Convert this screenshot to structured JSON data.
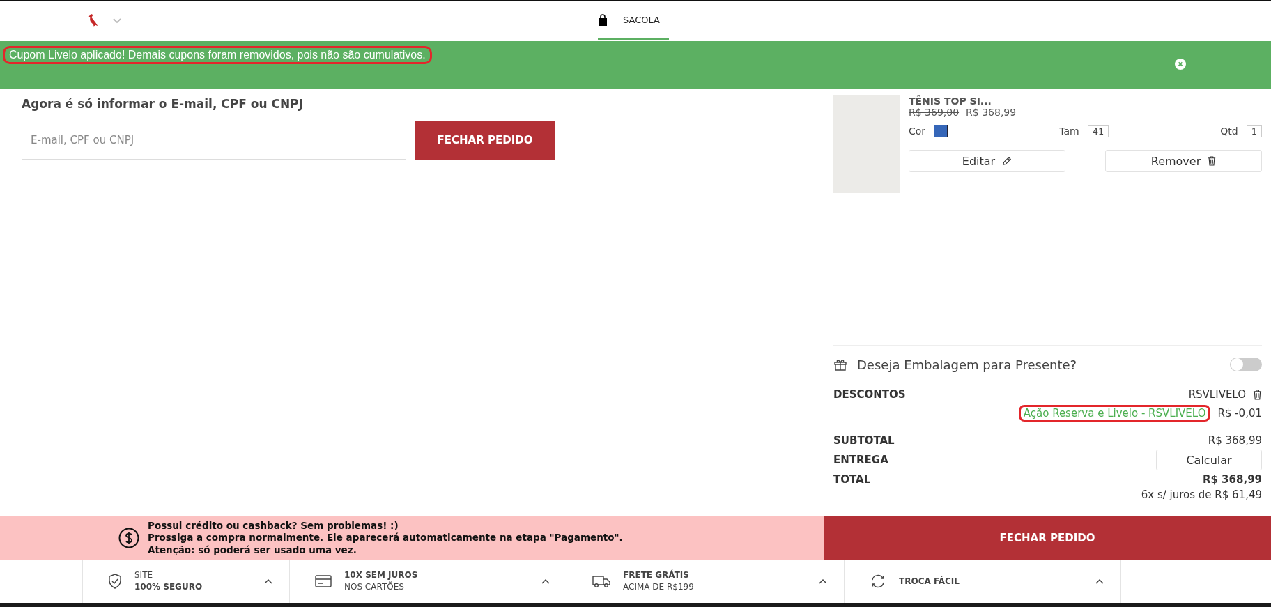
{
  "header": {
    "bag_label": "SACOLA"
  },
  "notice": {
    "message": "Cupom Livelo aplicado! Demais cupons foram removidos, pois não são cumulativos."
  },
  "identify": {
    "heading": "Agora é só informar o E-mail, CPF ou CNPJ",
    "field": {
      "placeholder": "E-mail, CPF ou CNPJ"
    },
    "button": "FECHAR PEDIDO"
  },
  "product": {
    "name": "TÊNIS TOP SI...",
    "old_price": "R$ 369,00",
    "price": "R$ 368,99",
    "color_label": "Cor",
    "color": "#3566b8",
    "size_label": "Tam",
    "size": "41",
    "qty_label": "Qtd",
    "qty": "1",
    "edit_button": "Editar",
    "remove_button": "Remover"
  },
  "gift": {
    "label": "Deseja Embalagem para Presente?",
    "on": false
  },
  "discounts": {
    "label": "DESCONTOS",
    "code": "RSVLIVELO",
    "promo": "Ação Reserva e Livelo - RSVLIVELO",
    "amount": "R$ -0,01"
  },
  "summary": {
    "subtotal_label": "SUBTOTAL",
    "subtotal": "R$ 368,99",
    "delivery_label": "ENTREGA",
    "delivery_button": "Calcular",
    "total_label": "TOTAL",
    "total": "R$ 368,99",
    "installments": "6x s/ juros de R$ 61,49"
  },
  "credit_notice": {
    "lines": [
      "Possui crédito ou cashback? Sem problemas! :)",
      "Prossiga a compra normalmente. Ele aparecerá automaticamente na etapa \"Pagamento\".",
      "Atenção: só poderá ser usado uma vez."
    ]
  },
  "checkout_button": "FECHAR PEDIDO",
  "footer": [
    {
      "kind": "shield",
      "line_1": "SITE",
      "line_2": "100% SEGURO",
      "first_bold": false
    },
    {
      "kind": "card",
      "line_1": "10X SEM JUROS",
      "line_2": "NOS CARTÕES",
      "first_bold": true
    },
    {
      "kind": "truck",
      "line_1": "FRETE GRÁTIS",
      "line_2": "ACIMA DE R$199",
      "first_bold": true
    },
    {
      "kind": "exchange",
      "line_1": "TROCA FÁCIL",
      "first_bold": true
    }
  ]
}
